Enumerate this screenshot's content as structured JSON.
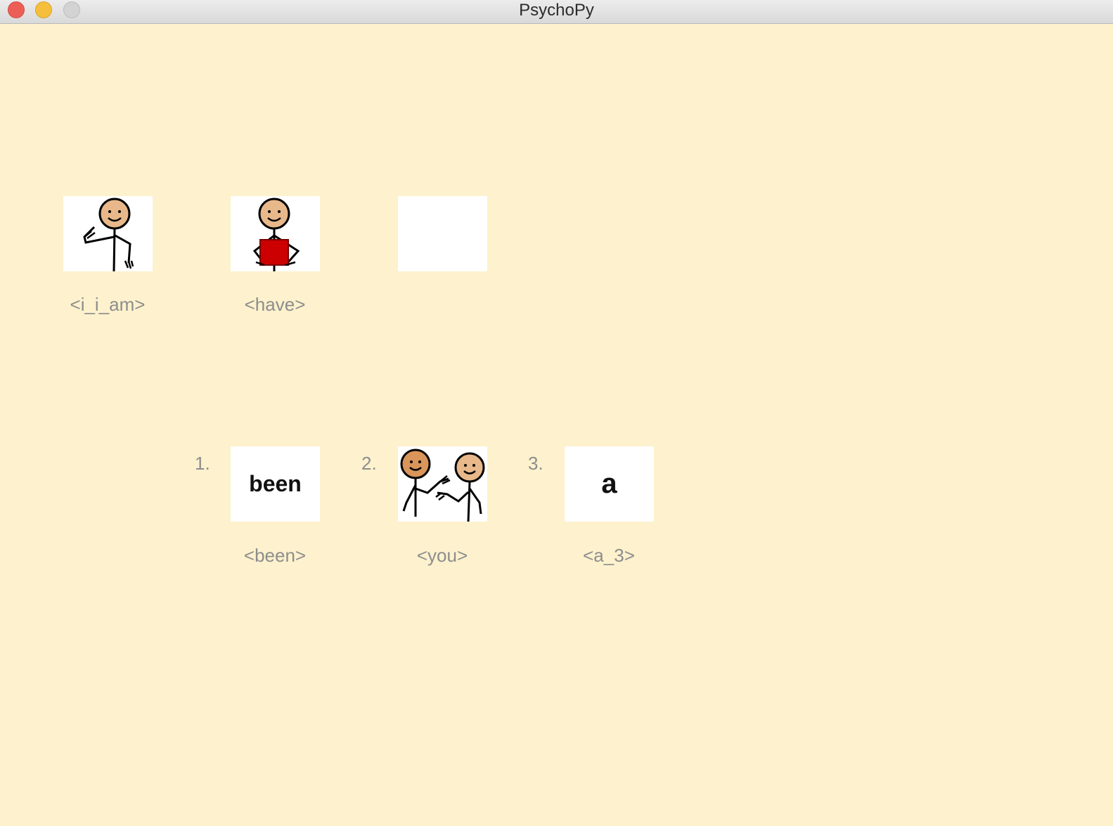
{
  "window": {
    "title": "PsychoPy",
    "close_icon": "close-icon",
    "minimize_icon": "minimize-icon",
    "maximize_icon": "maximize-icon"
  },
  "sentence": [
    {
      "label": "<i_i_am>",
      "icon": "person-pointing-self-icon"
    },
    {
      "label": "<have>",
      "icon": "person-holding-red-box-icon"
    },
    {
      "label": "",
      "icon": "empty-slot"
    }
  ],
  "options": [
    {
      "number": "1.",
      "word": "been",
      "label": "<been>",
      "icon": "been-word-icon"
    },
    {
      "number": "2.",
      "word": "",
      "label": "<you>",
      "icon": "two-people-pointing-icon"
    },
    {
      "number": "3.",
      "word": "a",
      "label": "<a_3>",
      "icon": "a-word-icon"
    }
  ],
  "colors": {
    "background": "#fdf2cd",
    "label_text": "#8d8d8d",
    "card": "#ffffff",
    "box_red": "#cc0000",
    "skin": "#e8b88a"
  }
}
